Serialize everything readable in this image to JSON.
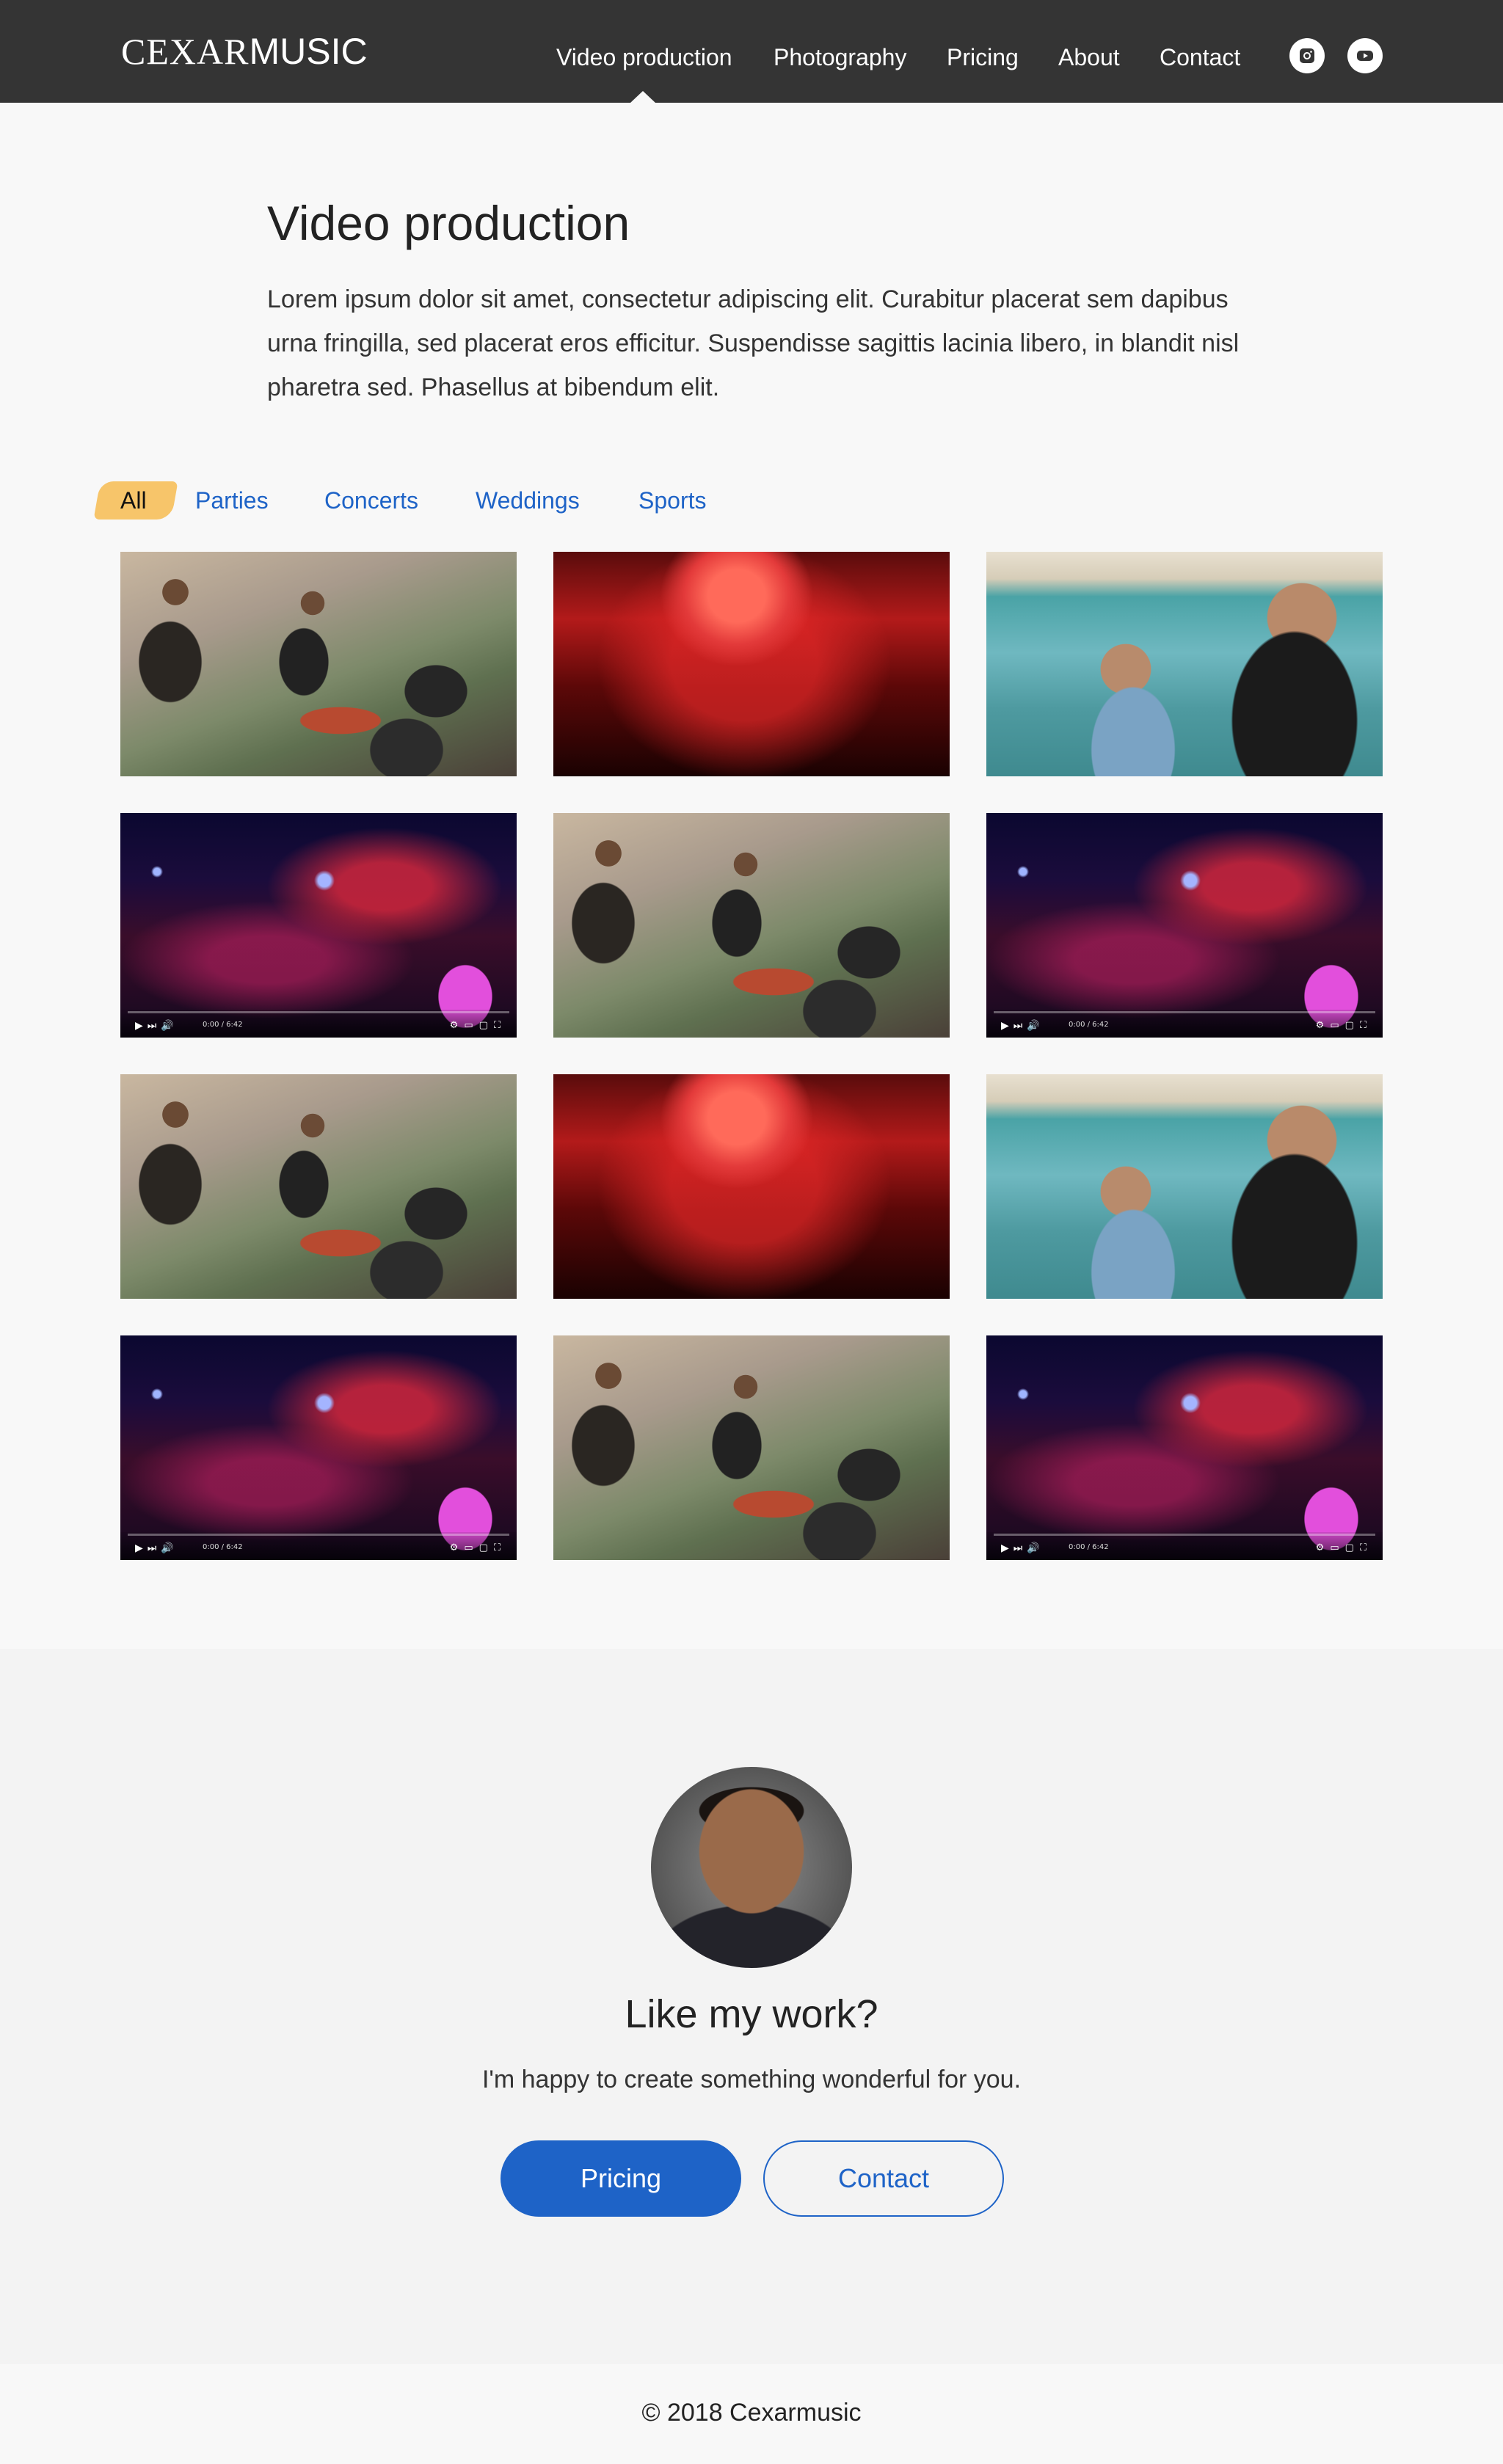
{
  "header": {
    "logo_bold": "CEXAR",
    "logo_light": "MUSIC",
    "nav": [
      {
        "label": "Video production"
      },
      {
        "label": "Photography"
      },
      {
        "label": "Pricing"
      },
      {
        "label": "About"
      },
      {
        "label": "Contact"
      }
    ],
    "social": [
      {
        "icon": "instagram-icon"
      },
      {
        "icon": "youtube-icon"
      }
    ]
  },
  "main": {
    "title": "Video production",
    "intro": "Lorem ipsum dolor sit amet, consectetur adipiscing elit. Curabitur placerat sem dapibus urna fringilla, sed placerat eros efficitur. Suspendisse sagittis lacinia libero, in blandit nisl pharetra sed. Phasellus at bibendum elit.",
    "filters": [
      {
        "label": "All",
        "active": true
      },
      {
        "label": "Parties"
      },
      {
        "label": "Concerts"
      },
      {
        "label": "Weddings"
      },
      {
        "label": "Sports"
      }
    ],
    "player_time": "0:00 / 6:42"
  },
  "cta": {
    "title": "Like my work?",
    "subtitle": "I'm happy to create something wonderful for you.",
    "primary_button": "Pricing",
    "secondary_button": "Contact"
  },
  "footer": {
    "copyright": "© 2018 Cexarmusic"
  },
  "colors": {
    "header_bg": "#343434",
    "accent": "#1e63c7",
    "filter_highlight": "#f7c56a"
  }
}
